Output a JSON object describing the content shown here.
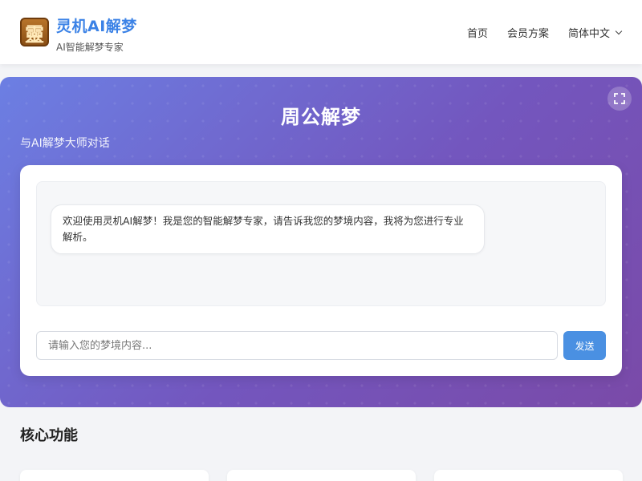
{
  "header": {
    "logo_char": "靈",
    "brand_title": "灵机AI解梦",
    "brand_subtitle": "AI智能解梦专家",
    "nav": {
      "home": "首页",
      "membership": "会员方案",
      "language": "简体中文"
    }
  },
  "hero": {
    "title": "周公解梦",
    "subtitle": "与AI解梦大师对话",
    "welcome_message": "欢迎使用灵机AI解梦！我是您的智能解梦专家，请告诉我您的梦境内容，我将为您进行专业解析。",
    "input_placeholder": "请输入您的梦境内容...",
    "send_label": "发送"
  },
  "features": {
    "title": "核心功能"
  },
  "colors": {
    "brand": "#3b82e6",
    "send_button": "#4a90e2",
    "hero_gradient_start": "#6c7fe3",
    "hero_gradient_end": "#7a4aa8"
  },
  "icons": {
    "logo": "ling-character-logo",
    "fullscreen": "fullscreen-icon",
    "language_dropdown": "chevron-down-icon"
  }
}
